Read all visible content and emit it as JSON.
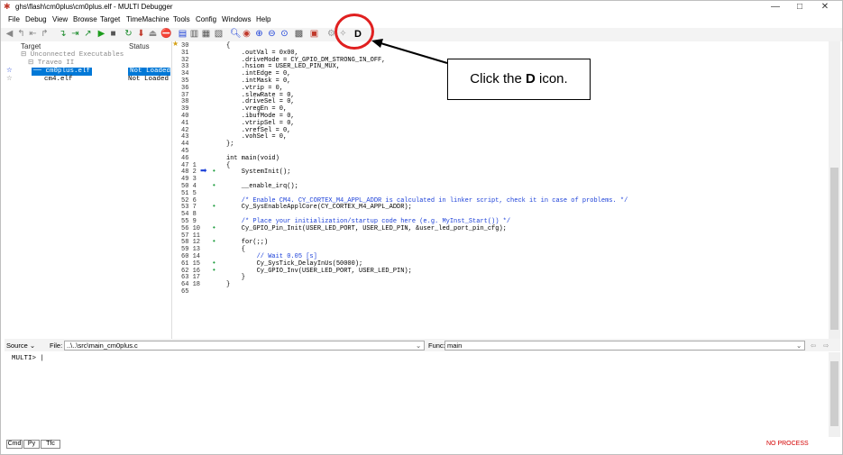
{
  "window": {
    "title": "ghs\\flash\\cm0plus\\cm0plus.elf - MULTI Debugger"
  },
  "menu": [
    "File",
    "Debug",
    "View",
    "Browse",
    "Target",
    "TimeMachine",
    "Tools",
    "Config",
    "Windows",
    "Help"
  ],
  "toolbar": {
    "d_icon": "D"
  },
  "target_pane": {
    "col_target": "Target",
    "col_status": "Status",
    "rows": [
      {
        "name": "⊟ Unconnected Executables",
        "status": ""
      },
      {
        "name": "⊟ Traveo II",
        "status": ""
      },
      {
        "name": "cm0plus.elf",
        "status": "Not Loaded"
      },
      {
        "name": "cm4.elf",
        "status": "Not Loaded"
      }
    ]
  },
  "gutter": [
    "30",
    "31",
    "32",
    "33",
    "34",
    "35",
    "36",
    "37",
    "38",
    "39",
    "40",
    "41",
    "42",
    "43",
    "44",
    "45",
    "46",
    "47 1",
    "48 2",
    "49 3",
    "50 4",
    "51 5",
    "52 6",
    "53 7",
    "54 8",
    "55 9",
    "56 10",
    "57 11",
    "58 12",
    "59 13",
    "60 14",
    "61 15",
    "62 16",
    "63 17",
    "64 18",
    "65"
  ],
  "code_lines": [
    "{",
    "    .outVal = 0x00,",
    "    .driveMode = CY_GPIO_DM_STRONG_IN_OFF,",
    "    .hsiom = USER_LED_PIN_MUX,",
    "    .intEdge = 0,",
    "    .intMask = 0,",
    "    .vtrip = 0,",
    "    .slewRate = 0,",
    "    .driveSel = 0,",
    "    .vregEn = 0,",
    "    .ibufMode = 0,",
    "    .vtripSel = 0,",
    "    .vrefSel = 0,",
    "    .vohSel = 0,",
    "};",
    "",
    "int main(void)",
    "{",
    "    SystemInit();",
    "",
    "    __enable_irq();",
    "",
    "    /* Enable CM4. CY_CORTEX_M4_APPL_ADDR is calculated in linker script, check it in case of problems. */",
    "    Cy_SysEnableApplCore(CY_CORTEX_M4_APPL_ADDR);",
    "",
    "    /* Place your initialization/startup code here (e.g. MyInst_Start()) */",
    "    Cy_GPIO_Pin_Init(USER_LED_PORT, USER_LED_PIN, &user_led_port_pin_cfg);",
    "",
    "    for(;;)",
    "    {",
    "        // Wait 0.05 [s]",
    "        Cy_SysTick_DelayInUs(50000);",
    "        Cy_GPIO_Inv(USER_LED_PORT, USER_LED_PIN);",
    "    }",
    "}",
    ""
  ],
  "callout": {
    "prefix": "Click the ",
    "bold": "D",
    "suffix": " icon."
  },
  "source_bar": {
    "source_label": "Source",
    "file_label": "File:",
    "file_value": "..\\..\\src\\main_cm0plus.c",
    "func_label": "Func:",
    "func_value": "main"
  },
  "cmd": {
    "prompt": "MULTI>"
  },
  "bottom": {
    "tabs": [
      "Cmd",
      "Py",
      "Tfc"
    ],
    "status": "NO PROCESS"
  }
}
